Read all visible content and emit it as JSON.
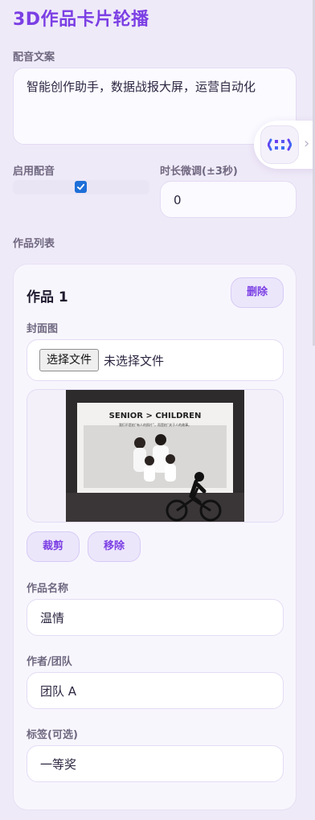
{
  "app": {
    "title": "3D作品卡片轮播"
  },
  "script": {
    "label": "配音文案",
    "value": "智能创作助手，数据战报大屏，运营自动化"
  },
  "voice": {
    "label": "启用配音",
    "checked": true
  },
  "duration": {
    "label": "时长微调(±3秒)",
    "value": "0"
  },
  "works": {
    "label": "作品列表",
    "items": [
      {
        "title": "作品 1",
        "delete_label": "删除",
        "cover": {
          "label": "封面图",
          "file_button": "选择文件",
          "file_status": "未选择文件",
          "image_heading": "SENIOR > CHILDREN",
          "image_caption": "我们不是拍“有人的照片”，而是拍“关于人的故事。",
          "crop_label": "裁剪",
          "remove_label": "移除"
        },
        "name": {
          "label": "作品名称",
          "value": "温情"
        },
        "author": {
          "label": "作者/团队",
          "value": "团队 A"
        },
        "tag": {
          "label": "标签(可选)",
          "value": "一等奖"
        }
      }
    ]
  },
  "colors": {
    "accent": "#7b3fe4",
    "background": "#efeaf8",
    "card": "#f8f6fd"
  }
}
